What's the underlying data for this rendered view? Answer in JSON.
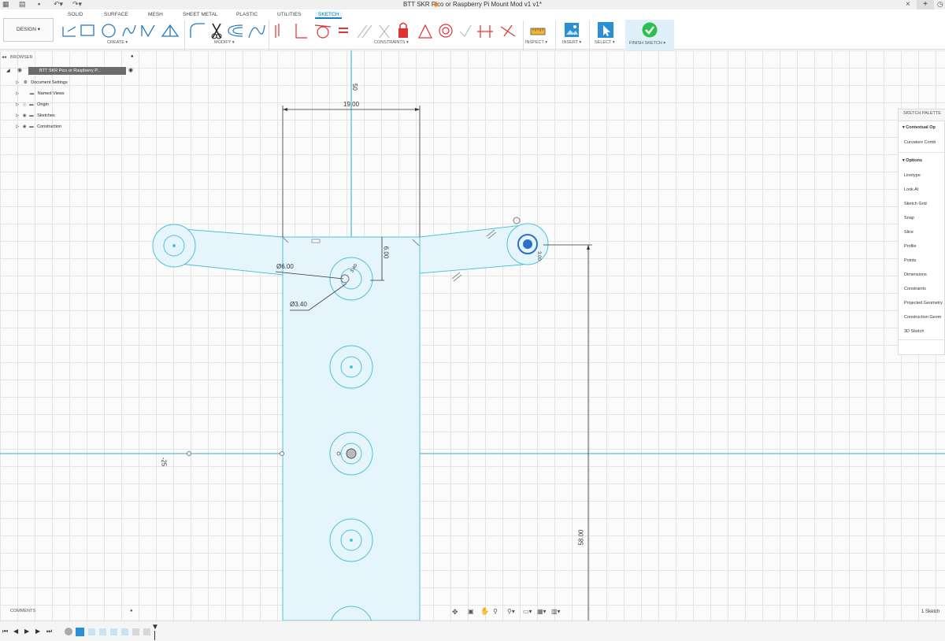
{
  "title_bar": {
    "title": "BTT SKR Pico or Raspberry Pi Mount Mod v1 v1*"
  },
  "ribbon": {
    "tabs": [
      "SOLID",
      "SURFACE",
      "MESH",
      "SHEET METAL",
      "PLASTIC",
      "UTILITIES",
      "SKETCH"
    ],
    "active_tab": "SKETCH",
    "workspace": "DESIGN ▾",
    "groups": {
      "create": "CREATE ▾",
      "modify": "MODIFY ▾",
      "constraints": "CONSTRAINTS ▾",
      "inspect": "INSPECT ▾",
      "insert": "INSERT ▾",
      "select": "SELECT ▾",
      "finish": "FINISH SKETCH ▾"
    },
    "accent_color": "#1a7fb8",
    "finish_color": "#2ec04b"
  },
  "browser": {
    "header": "BROWSER",
    "root": "BTT SKR Pico or Raspberry P...",
    "items": [
      "Document Settings",
      "Named Views",
      "Origin",
      "Sketches",
      "Construction"
    ]
  },
  "palette": {
    "header": "SKETCH PALETTE",
    "contextual": "Contextual Op",
    "curvature": "Curvature Comb",
    "options": "Options",
    "items": [
      "Linetype",
      "Look At",
      "Sketch Grid",
      "Snap",
      "Slice",
      "Profile",
      "Points",
      "Dimensions",
      "Constraints",
      "Projected Geometry",
      "Construction Geom",
      "3D Sketch"
    ]
  },
  "canvas": {
    "dimensions": {
      "width": "19.00",
      "axis_top": "50",
      "axis_left": "-25",
      "hole_dia": "Ø6.00",
      "small_dia": "Ø3.40",
      "offset": "6.00",
      "vertical": "58.00",
      "right_small": "3.00",
      "center_small": "3.40"
    },
    "sketch_color": "#4ec3d6",
    "fill_color": "#e6f4fb"
  },
  "comments": {
    "label": "COMMENTS"
  },
  "status": {
    "sketch_count": "1 Sketch"
  }
}
